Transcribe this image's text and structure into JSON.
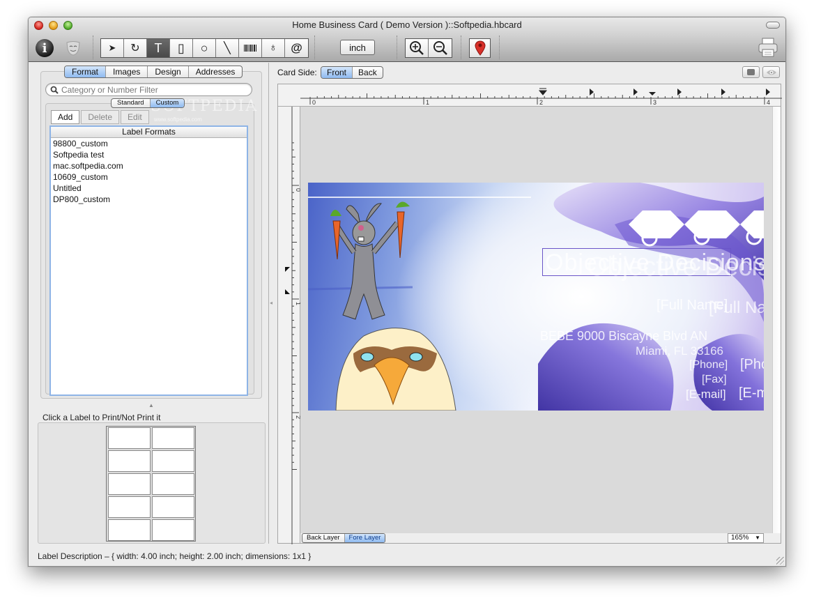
{
  "window": {
    "title": "Home Business Card ( Demo Version )::Softpedia.hbcard"
  },
  "toolbar": {
    "left_icons": [
      "info-icon",
      "theater-mask-icon"
    ],
    "tools": [
      {
        "name": "select",
        "glyph": "➤",
        "icon": "arrow-pointer-icon",
        "active": false
      },
      {
        "name": "rotate",
        "glyph": "↻",
        "icon": "rotate-icon",
        "active": false
      },
      {
        "name": "text",
        "glyph": "T",
        "icon": "text-tool-icon",
        "active": true
      },
      {
        "name": "rectangle",
        "glyph": "▯",
        "icon": "rectangle-icon",
        "active": false
      },
      {
        "name": "ellipse",
        "glyph": "○",
        "icon": "ellipse-icon",
        "active": false
      },
      {
        "name": "line",
        "glyph": "╲",
        "icon": "line-icon",
        "active": false
      },
      {
        "name": "barcode",
        "glyph": "▥",
        "icon": "barcode-icon",
        "active": false
      },
      {
        "name": "image",
        "glyph": "♁",
        "icon": "image-tool-icon",
        "active": false
      },
      {
        "name": "address",
        "glyph": "@",
        "icon": "at-sign-icon",
        "active": false
      }
    ],
    "unit_label": "inch",
    "zoom_in_icon": "zoom-in-icon",
    "zoom_out_icon": "zoom-out-icon",
    "pin_icon": "map-pin-icon",
    "print_icon": "printer-icon"
  },
  "left_panel": {
    "tabs": [
      {
        "label": "Format",
        "active": true
      },
      {
        "label": "Images",
        "active": false
      },
      {
        "label": "Design",
        "active": false
      },
      {
        "label": "Addresses",
        "active": false
      }
    ],
    "search": {
      "placeholder": "Category or Number Filter",
      "value": ""
    },
    "format_type": [
      {
        "label": "Standard",
        "active": false
      },
      {
        "label": "Custom",
        "active": true
      }
    ],
    "watermark": "SOFTPEDIA",
    "watermark_url": "www.softpedia.com",
    "actions": [
      {
        "label": "Add",
        "enabled": true
      },
      {
        "label": "Delete",
        "enabled": false
      },
      {
        "label": "Edit",
        "enabled": false
      }
    ],
    "list_header": "Label Formats",
    "list_items": [
      "98800_custom",
      "Softpedia test",
      "mac.softpedia.com",
      "10609_custom",
      "Untitled",
      "DP800_custom"
    ],
    "print_hint": "Click a Label to Print/Not Print it",
    "sheet": {
      "rows": 5,
      "cols": 2
    }
  },
  "status_bar": {
    "text": "Label Description – { width: 4.00 inch; height: 2.00 inch; dimensions: 1x1 }"
  },
  "editor": {
    "card_side_label": "Card Side:",
    "card_sides": [
      {
        "label": "Front",
        "active": true
      },
      {
        "label": "Back",
        "active": false
      }
    ],
    "view_buttons": [
      "rectangle-view-icon",
      "eye-icon"
    ],
    "ruler_h_labels": [
      "0",
      "1",
      "2",
      "3",
      "4"
    ],
    "ruler_v_labels": [
      "0",
      "1",
      "2"
    ],
    "layers": [
      {
        "label": "Back Layer",
        "active": false
      },
      {
        "label": "Fore Layer",
        "active": true
      }
    ],
    "zoom_level": "165%",
    "card": {
      "title_text": "Objective Decisions",
      "name_text": "[Full Name]",
      "address_text": "BEBE 9000 Biscayne Blvd AN",
      "city_text": "Miami, FL 33166",
      "phone_text": "[Phone]",
      "fax_text": "[Fax]",
      "email_text": "[E-mail]",
      "colors": {
        "accent_purple": "#6a55c8",
        "sky_blue": "#5a74d0"
      }
    }
  }
}
